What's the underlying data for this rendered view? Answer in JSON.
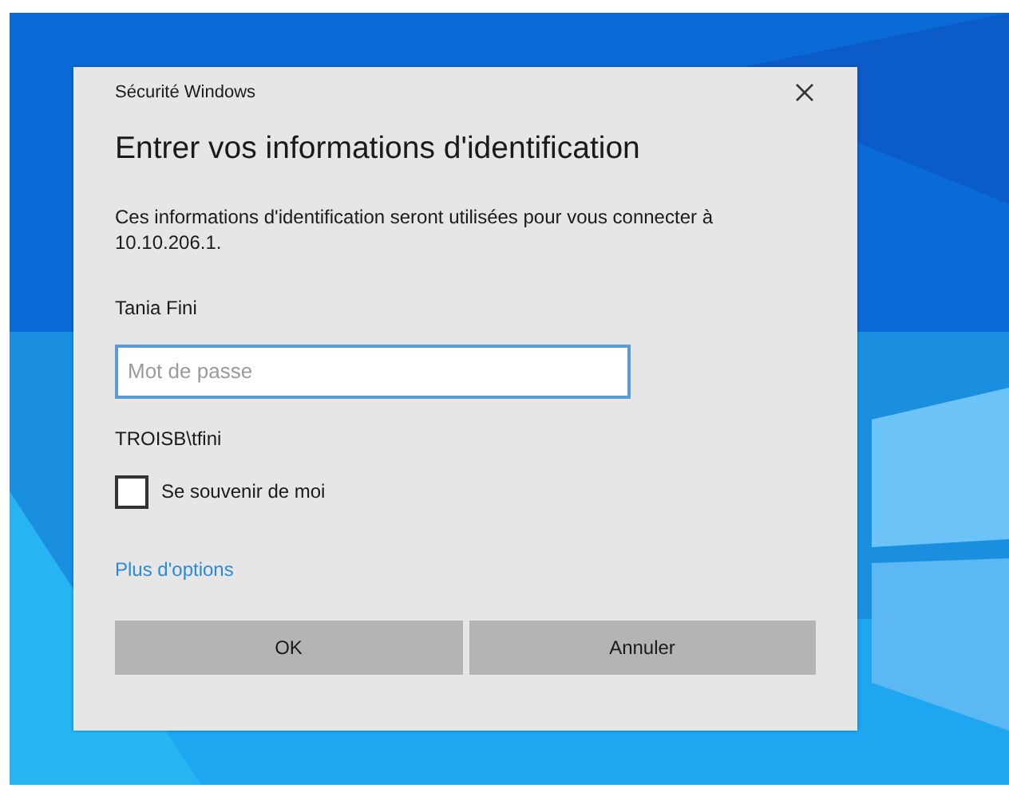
{
  "dialog": {
    "window_title": "Sécurité Windows",
    "heading": "Entrer vos informations d'identification",
    "message": "Ces informations d'identification seront utilisées pour vous connecter à 10.10.206.1.",
    "user_name": "Tania Fini",
    "password": {
      "placeholder": "Mot de passe"
    },
    "account": "TROISB\\tfini",
    "remember": {
      "label": "Se souvenir de moi",
      "checked": false
    },
    "more_options": "Plus d'options",
    "buttons": [
      {
        "label": "OK"
      },
      {
        "label": "Annuler"
      }
    ]
  }
}
